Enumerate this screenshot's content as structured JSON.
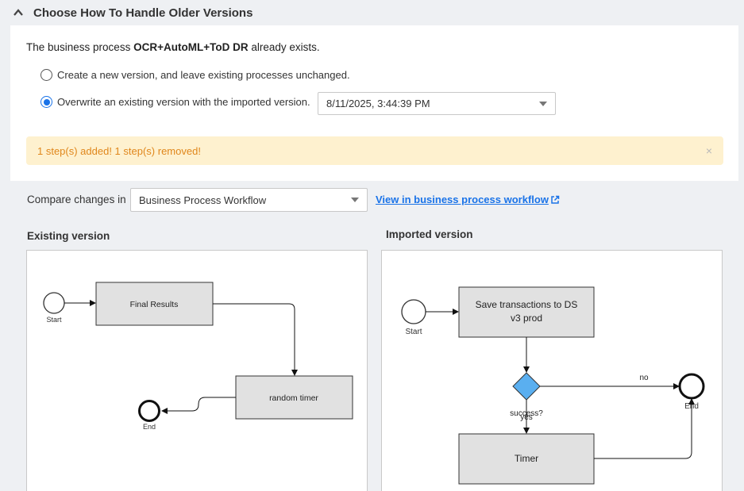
{
  "header": {
    "title": "Choose How To Handle Older Versions"
  },
  "intro": {
    "prefix": "The business process ",
    "process_name": "OCR+AutoML+ToD DR",
    "suffix": " already exists."
  },
  "options": [
    {
      "label": "Create a new version, and leave existing processes  unchanged.",
      "selected": false
    },
    {
      "label": "Overwrite an existing version with the imported version.",
      "selected": true
    }
  ],
  "version_select": {
    "value": "8/11/2025, 3:44:39 PM"
  },
  "alert": {
    "message": "1 step(s) added! 1 step(s) removed!",
    "close": "×"
  },
  "compare": {
    "label": "Compare changes in",
    "select_value": "Business Process Workflow",
    "link_text": "View in business process workflow"
  },
  "existing": {
    "title": "Existing version",
    "start_label": "Start",
    "end_label": "End",
    "step1": "Final Results",
    "step2": "random timer"
  },
  "imported": {
    "title": "Imported version",
    "start_label": "Start",
    "end_label": "End",
    "step1_line1": "Save transactions to DS",
    "step1_line2": "v3 prod",
    "decision_label": "success?",
    "yes_label": "yes",
    "no_label": "no",
    "step2": "Timer"
  },
  "colors": {
    "accent": "#1a73e8",
    "alert_bg": "#fef1cf",
    "alert_text": "#e0871c",
    "step_fill": "#e1e1e1",
    "decision_fill": "#5aaff0"
  }
}
